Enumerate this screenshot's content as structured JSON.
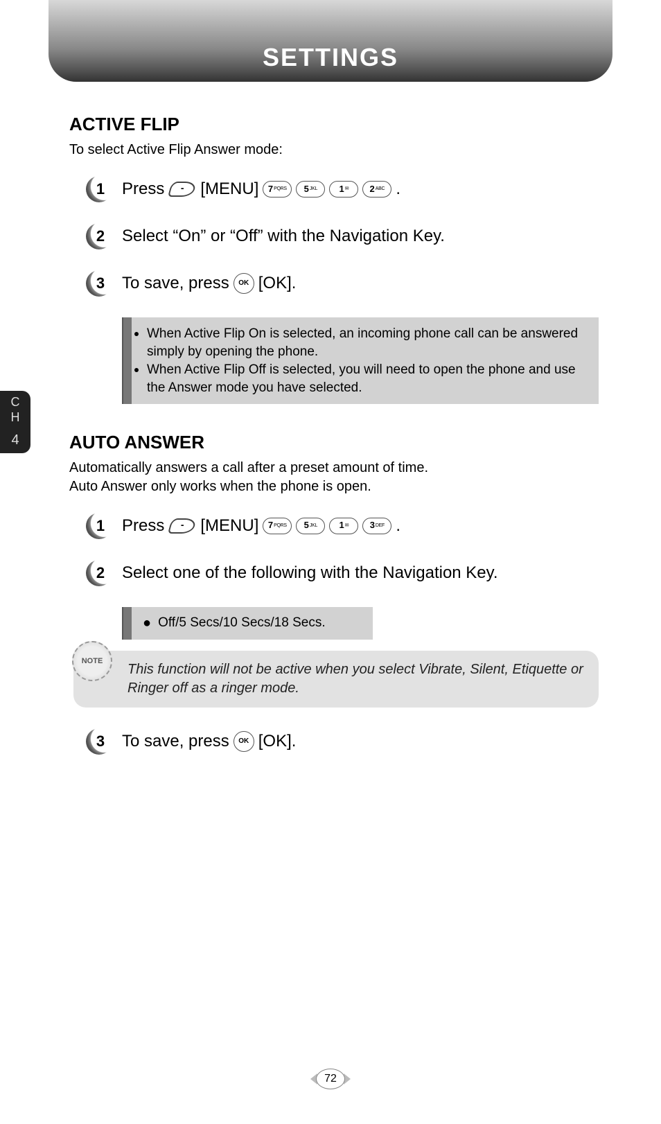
{
  "header": {
    "title": "SETTINGS"
  },
  "chapter_tab": {
    "label": "C\nH",
    "num": "4"
  },
  "page_number": "72",
  "sections": {
    "active_flip": {
      "title": "ACTIVE FLIP",
      "intro": "To select Active Flip Answer mode:",
      "step1_a": "Press",
      "step1_b": "[MENU]",
      "step1_c": ".",
      "step1_keys": [
        {
          "digit": "7",
          "sub": "PQRS"
        },
        {
          "digit": "5",
          "sub": "JKL"
        },
        {
          "digit": "1",
          "sub": "✉"
        },
        {
          "digit": "2",
          "sub": "ABC"
        }
      ],
      "step2": "Select “On” or “Off” with the Navigation Key.",
      "step3_a": "To save, press",
      "step3_b": "[OK].",
      "info": [
        "When Active Flip On is selected, an incoming phone call can be answered simply by opening the phone.",
        "When Active Flip Off is selected, you will need to open the phone and use the Answer mode you have selected."
      ]
    },
    "auto_answer": {
      "title": "AUTO ANSWER",
      "intro": "Automatically answers a call after a preset amount of time.\nAuto Answer only works when the phone is open.",
      "step1_a": "Press",
      "step1_b": "[MENU]",
      "step1_c": ".",
      "step1_keys": [
        {
          "digit": "7",
          "sub": "PQRS"
        },
        {
          "digit": "5",
          "sub": "JKL"
        },
        {
          "digit": "1",
          "sub": "✉"
        },
        {
          "digit": "3",
          "sub": "DEF"
        }
      ],
      "step2": "Select one of the following with the Navigation Key.",
      "options": "Off/5 Secs/10 Secs/18 Secs.",
      "note_label": "NOTE",
      "note": "This function will not be active when you select Vibrate, Silent, Etiquette or Ringer off as a ringer mode.",
      "step3_a": "To save, press",
      "step3_b": "[OK]."
    }
  },
  "ok_label": "OK"
}
